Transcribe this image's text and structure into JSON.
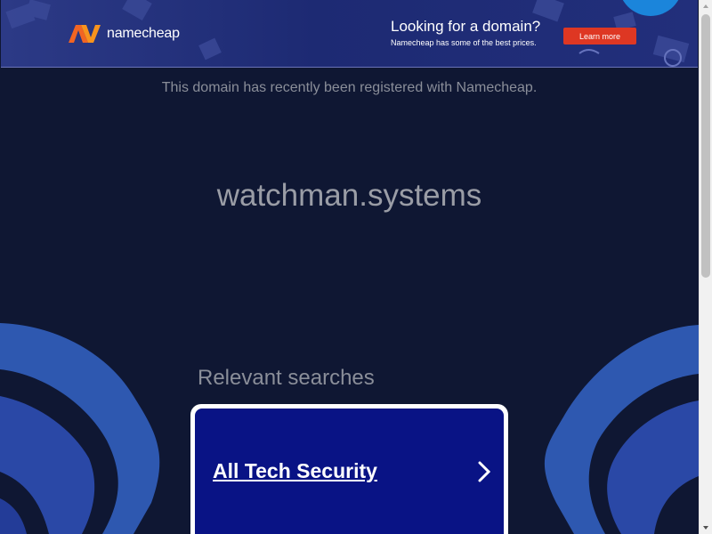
{
  "banner": {
    "brand": "namecheap",
    "promo_heading": "Looking for a domain?",
    "promo_sub": "Namecheap has some of the best prices.",
    "cta_label": "Learn more"
  },
  "notice": "This domain has recently been registered with Namecheap.",
  "domain_name": "watchman.systems",
  "relevant": {
    "title": "Relevant searches",
    "items": [
      {
        "label": "All Tech Security"
      }
    ]
  },
  "colors": {
    "background": "#0f1733",
    "card": "#091385",
    "cta": "#de3723",
    "logo_orange": "#f26522"
  },
  "icons": [
    "namecheap-logo-icon",
    "chevron-right-icon",
    "scroll-up-icon",
    "scroll-down-icon"
  ]
}
